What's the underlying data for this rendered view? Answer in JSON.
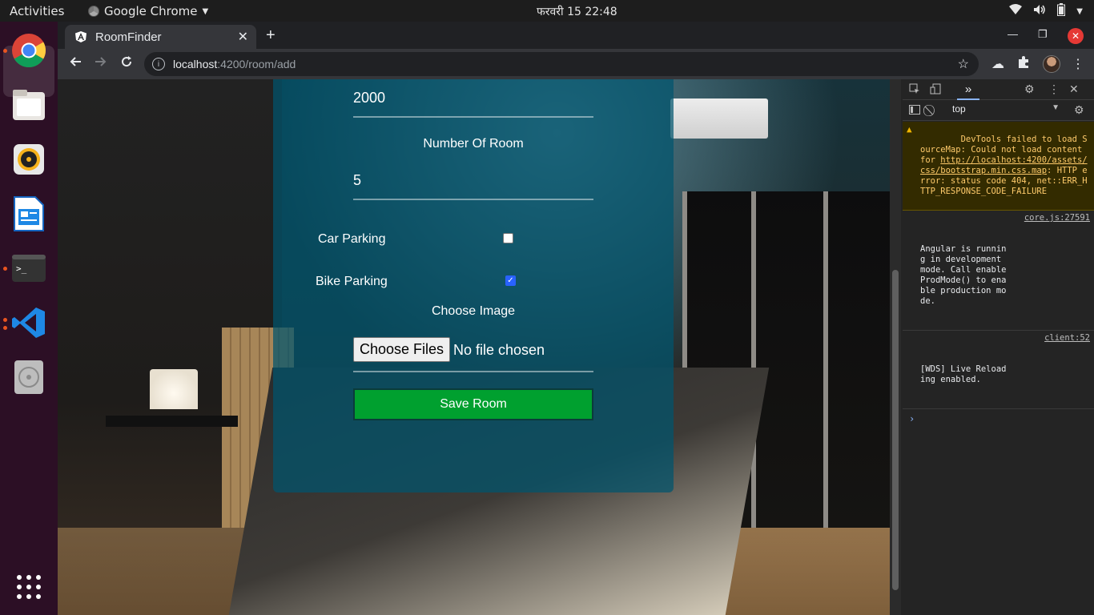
{
  "topbar": {
    "activities": "Activities",
    "app_name": "Google Chrome",
    "clock": "फरवरी 15  22:48"
  },
  "dock": {
    "items": [
      "chrome-icon",
      "files-icon",
      "rhythmbox-icon",
      "writer-icon",
      "terminal-icon",
      "vscode-icon",
      "disc-icon",
      "app-grid-icon"
    ]
  },
  "browser": {
    "tab_title": "RoomFinder",
    "url_host": "localhost",
    "url_path": ":4200/room/add"
  },
  "form": {
    "price_value": "2000",
    "rooms_label": "Number Of Room",
    "rooms_value": "5",
    "car_label": "Car Parking",
    "car_checked": false,
    "bike_label": "Bike Parking",
    "bike_checked": true,
    "image_label": "Choose Image",
    "file_button": "Choose Files",
    "file_status": "No file chosen",
    "save_button": "Save Room"
  },
  "devtools": {
    "context": "top",
    "messages": [
      {
        "type": "warning",
        "text_before": "DevTools failed to load SourceMap: Could not load content for ",
        "link": "http://localhost:4200/assets/css/bootstrap.min.css.map",
        "text_after": ": HTTP error: status code 404, net::ERR_HTTP_RESPONSE_CODE_FAILURE"
      },
      {
        "type": "log",
        "text": "Angular is running in development mode. Call enableProdMode() to enable production mode.",
        "source": "core.js:27591"
      },
      {
        "type": "log",
        "text": "[WDS] Live Reloading enabled.",
        "source": "client:52"
      }
    ]
  },
  "colors": {
    "save_button": "#00a02f",
    "form_panel": "#00556e",
    "ubuntu_dock": "#2c0f25",
    "close_button": "#e53935"
  }
}
